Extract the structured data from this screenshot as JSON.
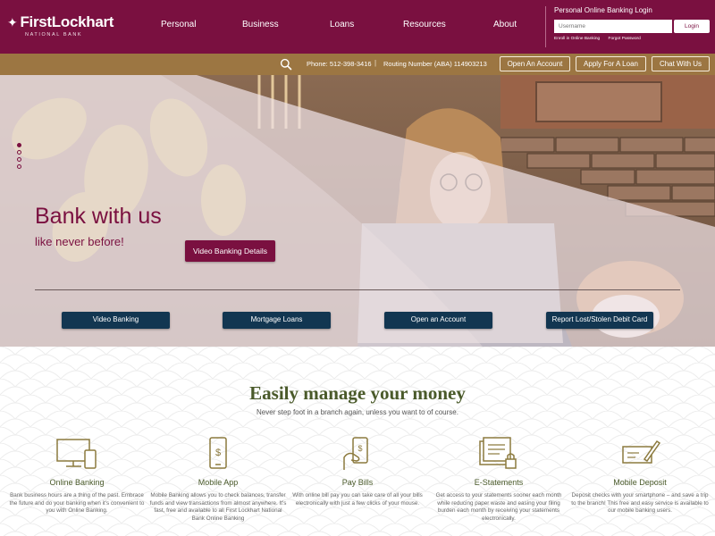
{
  "brand": {
    "name": "FirstLockhart",
    "tagline": "NATIONAL BANK",
    "mark": "✦"
  },
  "nav": [
    {
      "label": "Personal"
    },
    {
      "label": "Business"
    },
    {
      "label": "Loans"
    },
    {
      "label": "Resources"
    },
    {
      "label": "About"
    }
  ],
  "login": {
    "title": "Personal Online Banking Login",
    "username_placeholder": "Username",
    "button": "Login",
    "enroll": "Enroll in Online Banking",
    "forgot": "Forgot Password"
  },
  "utility": {
    "search_icon": "search-icon",
    "phone": "Phone: 512-398-3416",
    "separator": "|",
    "routing": "Routing Number (ABA) 114903213",
    "buttons": [
      "Open An Account",
      "Apply For A Loan",
      "Chat With Us"
    ]
  },
  "hero": {
    "title": "Bank with us",
    "subtitle": "like never before!",
    "cta": "Video Banking Details",
    "slides": 4,
    "active_slide": 1,
    "quick_links": [
      "Video Banking",
      "Mortgage Loans",
      "Open an Account",
      "Report Lost/Stolen Debit Card"
    ]
  },
  "manage": {
    "title": "Easily manage your money",
    "subtitle": "Never step foot in a branch again, unless you want to of course.",
    "features": [
      {
        "icon": "devices-icon",
        "title": "Online Banking",
        "desc": "Bank business hours are a thing of the past. Embrace the future and do your banking when it's convenient to you with Online Banking."
      },
      {
        "icon": "smartphone-dollar-icon",
        "title": "Mobile App",
        "desc": "Mobile Banking allows you to check balances, transfer funds and view transactions from almost anywhere. It's fast, free and available to all First Lockhart National Bank Online Banking"
      },
      {
        "icon": "hand-phone-bill-icon",
        "title": "Pay Bills",
        "desc": "With online bill pay you can take care of all your bills electronically with just a few clicks of your mouse."
      },
      {
        "icon": "statements-lock-icon",
        "title": "E-Statements",
        "desc": "Get access to your statements sooner each month while reducing paper waste and easing your filing burden each month by receiving your statements electronically."
      },
      {
        "icon": "check-pen-icon",
        "title": "Mobile Deposit",
        "desc": "Deposit checks with your smartphone – and save a trip to the branch! This free and easy service is available to our mobile banking users."
      }
    ]
  },
  "colors": {
    "brand": "#7a1040",
    "gold": "#9c7642",
    "navy": "#123651",
    "olive": "#4a5a2a"
  }
}
